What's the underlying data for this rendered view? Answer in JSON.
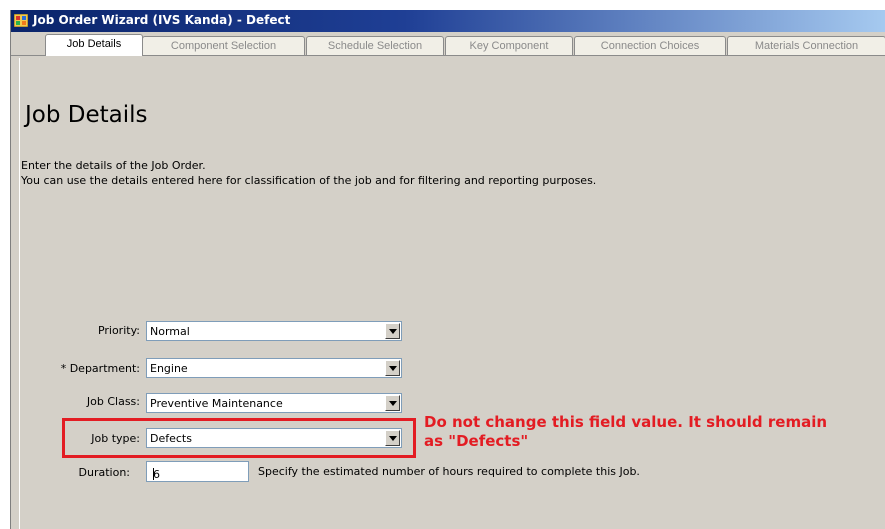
{
  "window": {
    "title": "Job Order Wizard (IVS Kanda) - Defect"
  },
  "tabs": [
    {
      "label": "Job Details",
      "active": true
    },
    {
      "label": "Component Selection",
      "active": false
    },
    {
      "label": "Schedule Selection",
      "active": false
    },
    {
      "label": "Key Component",
      "active": false
    },
    {
      "label": "Connection Choices",
      "active": false
    },
    {
      "label": "Materials Connection",
      "active": false
    }
  ],
  "page": {
    "heading": "Job Details",
    "intro_line1": "Enter the details of the Job Order.",
    "intro_line2": "You can use the details entered here for classification of the job and for filtering and reporting purposes."
  },
  "form": {
    "priority": {
      "label": "Priority:",
      "value": "Normal"
    },
    "department": {
      "label": "* Department:",
      "value": "Engine"
    },
    "job_class": {
      "label": "Job Class:",
      "value": "Preventive Maintenance"
    },
    "job_type": {
      "label": "Job type:",
      "value": "Defects"
    },
    "duration": {
      "label": "Duration:",
      "value": "6",
      "hint": "Specify the estimated number of hours required to complete this Job."
    }
  },
  "annotation": {
    "line1": "Do not change this field value. It should remain",
    "line2": "as \"Defects\"",
    "color": "#e31c23"
  },
  "icons": {
    "app": "app-icon"
  }
}
